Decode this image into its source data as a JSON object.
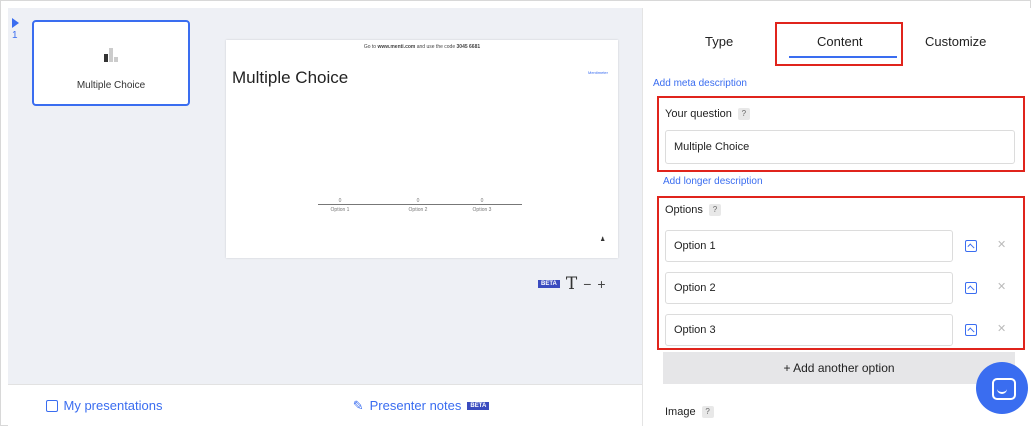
{
  "left": {
    "slide_number": "1",
    "thumb_label": "Multiple Choice",
    "my_presentations": "My presentations"
  },
  "slide": {
    "top_text_pre": "Go to ",
    "top_text_site": "www.menti.com",
    "top_text_mid": " and use the code ",
    "top_text_code": "3045 6681",
    "brand": "Mentimeter",
    "title": "Multiple Choice",
    "options": [
      {
        "count": "0",
        "label": "Option 1"
      },
      {
        "count": "0",
        "label": "Option 2"
      },
      {
        "count": "0",
        "label": "Option 3"
      }
    ]
  },
  "toolbar": {
    "beta": "BETA",
    "text_tool": "T",
    "minus": "−",
    "plus": "+"
  },
  "presenter_notes": {
    "label": "Presenter notes",
    "beta": "BETA"
  },
  "tabs": {
    "type": "Type",
    "content": "Content",
    "customize": "Customize"
  },
  "content": {
    "add_meta": "Add meta description",
    "question_label": "Your question",
    "question_value": "Multiple Choice",
    "add_longer": "Add longer description",
    "options_label": "Options",
    "options": [
      "Option 1",
      "Option 2",
      "Option 3"
    ],
    "add_option": "+ Add another option",
    "image_label": "Image",
    "help": "?"
  },
  "colors": {
    "accent": "#3a6df0",
    "highlight": "#e0241c"
  }
}
